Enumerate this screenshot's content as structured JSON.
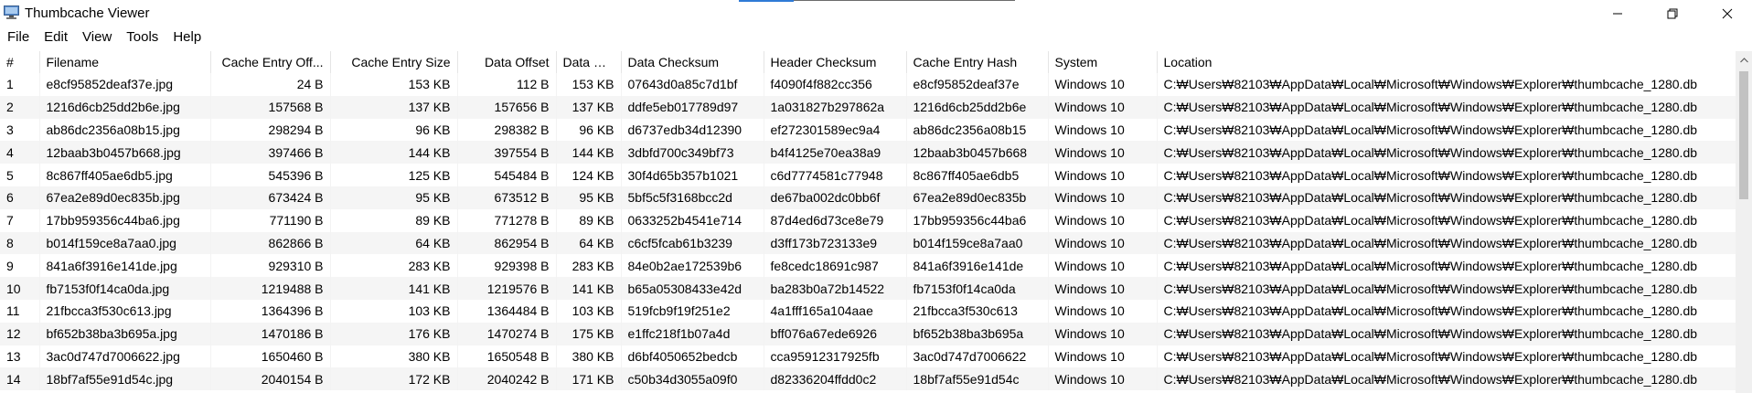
{
  "window": {
    "title": "Thumbcache Viewer",
    "icons": {
      "app": "thumbcache-app-icon",
      "minimize": "minimize-icon",
      "maximize": "restore-icon",
      "close": "close-icon"
    }
  },
  "menu": [
    "File",
    "Edit",
    "View",
    "Tools",
    "Help"
  ],
  "table": {
    "columns": [
      "#",
      "Filename",
      "Cache Entry Off...",
      "Cache Entry Size",
      "Data Offset",
      "Data Size",
      "Data Checksum",
      "Header Checksum",
      "Cache Entry Hash",
      "System",
      "Location"
    ],
    "rows": [
      [
        "1",
        "e8cf95852deaf37e.jpg",
        "24 B",
        "153 KB",
        "112 B",
        "153 KB",
        "07643d0a85c7d1bf",
        "f4090f4f882cc356",
        "e8cf95852deaf37e",
        "Windows 10",
        "C:₩Users₩82103₩AppData₩Local₩Microsoft₩Windows₩Explorer₩thumbcache_1280.db"
      ],
      [
        "2",
        "1216d6cb25dd2b6e.jpg",
        "157568 B",
        "137 KB",
        "157656 B",
        "137 KB",
        "ddfe5eb017789d97",
        "1a031827b297862a",
        "1216d6cb25dd2b6e",
        "Windows 10",
        "C:₩Users₩82103₩AppData₩Local₩Microsoft₩Windows₩Explorer₩thumbcache_1280.db"
      ],
      [
        "3",
        "ab86dc2356a08b15.jpg",
        "298294 B",
        "96 KB",
        "298382 B",
        "96 KB",
        "d6737edb34d12390",
        "ef272301589ec9a4",
        "ab86dc2356a08b15",
        "Windows 10",
        "C:₩Users₩82103₩AppData₩Local₩Microsoft₩Windows₩Explorer₩thumbcache_1280.db"
      ],
      [
        "4",
        "12baab3b0457b668.jpg",
        "397466 B",
        "144 KB",
        "397554 B",
        "144 KB",
        "3dbfd700c349bf73",
        "b4f4125e70ea38a9",
        "12baab3b0457b668",
        "Windows 10",
        "C:₩Users₩82103₩AppData₩Local₩Microsoft₩Windows₩Explorer₩thumbcache_1280.db"
      ],
      [
        "5",
        "8c867ff405ae6db5.jpg",
        "545396 B",
        "125 KB",
        "545484 B",
        "124 KB",
        "30f4d65b357b1021",
        "c6d7774581c77948",
        "8c867ff405ae6db5",
        "Windows 10",
        "C:₩Users₩82103₩AppData₩Local₩Microsoft₩Windows₩Explorer₩thumbcache_1280.db"
      ],
      [
        "6",
        "67ea2e89d0ec835b.jpg",
        "673424 B",
        "95 KB",
        "673512 B",
        "95 KB",
        "5bf5c5f3168bcc2d",
        "de67ba002dc0bb6f",
        "67ea2e89d0ec835b",
        "Windows 10",
        "C:₩Users₩82103₩AppData₩Local₩Microsoft₩Windows₩Explorer₩thumbcache_1280.db"
      ],
      [
        "7",
        "17bb959356c44ba6.jpg",
        "771190 B",
        "89 KB",
        "771278 B",
        "89 KB",
        "0633252b4541e714",
        "87d4ed6d73ce8e79",
        "17bb959356c44ba6",
        "Windows 10",
        "C:₩Users₩82103₩AppData₩Local₩Microsoft₩Windows₩Explorer₩thumbcache_1280.db"
      ],
      [
        "8",
        "b014f159ce8a7aa0.jpg",
        "862866 B",
        "64 KB",
        "862954 B",
        "64 KB",
        "c6cf5fcab61b3239",
        "d3ff173b723133e9",
        "b014f159ce8a7aa0",
        "Windows 10",
        "C:₩Users₩82103₩AppData₩Local₩Microsoft₩Windows₩Explorer₩thumbcache_1280.db"
      ],
      [
        "9",
        "841a6f3916e141de.jpg",
        "929310 B",
        "283 KB",
        "929398 B",
        "283 KB",
        "84e0b2ae172539b6",
        "fe8cedc18691c987",
        "841a6f3916e141de",
        "Windows 10",
        "C:₩Users₩82103₩AppData₩Local₩Microsoft₩Windows₩Explorer₩thumbcache_1280.db"
      ],
      [
        "10",
        "fb7153f0f14ca0da.jpg",
        "1219488 B",
        "141 KB",
        "1219576 B",
        "141 KB",
        "b65a05308433e42d",
        "ba283b0a72b14522",
        "fb7153f0f14ca0da",
        "Windows 10",
        "C:₩Users₩82103₩AppData₩Local₩Microsoft₩Windows₩Explorer₩thumbcache_1280.db"
      ],
      [
        "11",
        "21fbcca3f530c613.jpg",
        "1364396 B",
        "103 KB",
        "1364484 B",
        "103 KB",
        "519fcb9f19f251e2",
        "4a1fff165a104aae",
        "21fbcca3f530c613",
        "Windows 10",
        "C:₩Users₩82103₩AppData₩Local₩Microsoft₩Windows₩Explorer₩thumbcache_1280.db"
      ],
      [
        "12",
        "bf652b38ba3b695a.jpg",
        "1470186 B",
        "176 KB",
        "1470274 B",
        "175 KB",
        "e1ffc218f1b07a4d",
        "bff076a67ede6926",
        "bf652b38ba3b695a",
        "Windows 10",
        "C:₩Users₩82103₩AppData₩Local₩Microsoft₩Windows₩Explorer₩thumbcache_1280.db"
      ],
      [
        "13",
        "3ac0d747d7006622.jpg",
        "1650460 B",
        "380 KB",
        "1650548 B",
        "380 KB",
        "d6bf4050652bedcb",
        "cca95912317925fb",
        "3ac0d747d7006622",
        "Windows 10",
        "C:₩Users₩82103₩AppData₩Local₩Microsoft₩Windows₩Explorer₩thumbcache_1280.db"
      ],
      [
        "14",
        "18bf7af55e91d54c.jpg",
        "2040154 B",
        "172 KB",
        "2040242 B",
        "171 KB",
        "c50b34d3055a09f0",
        "d82336204ffdd0c2",
        "18bf7af55e91d54c",
        "Windows 10",
        "C:₩Users₩82103₩AppData₩Local₩Microsoft₩Windows₩Explorer₩thumbcache_1280.db"
      ]
    ]
  },
  "scrollbar": {
    "up_icon": "scroll-up-arrow-icon"
  }
}
